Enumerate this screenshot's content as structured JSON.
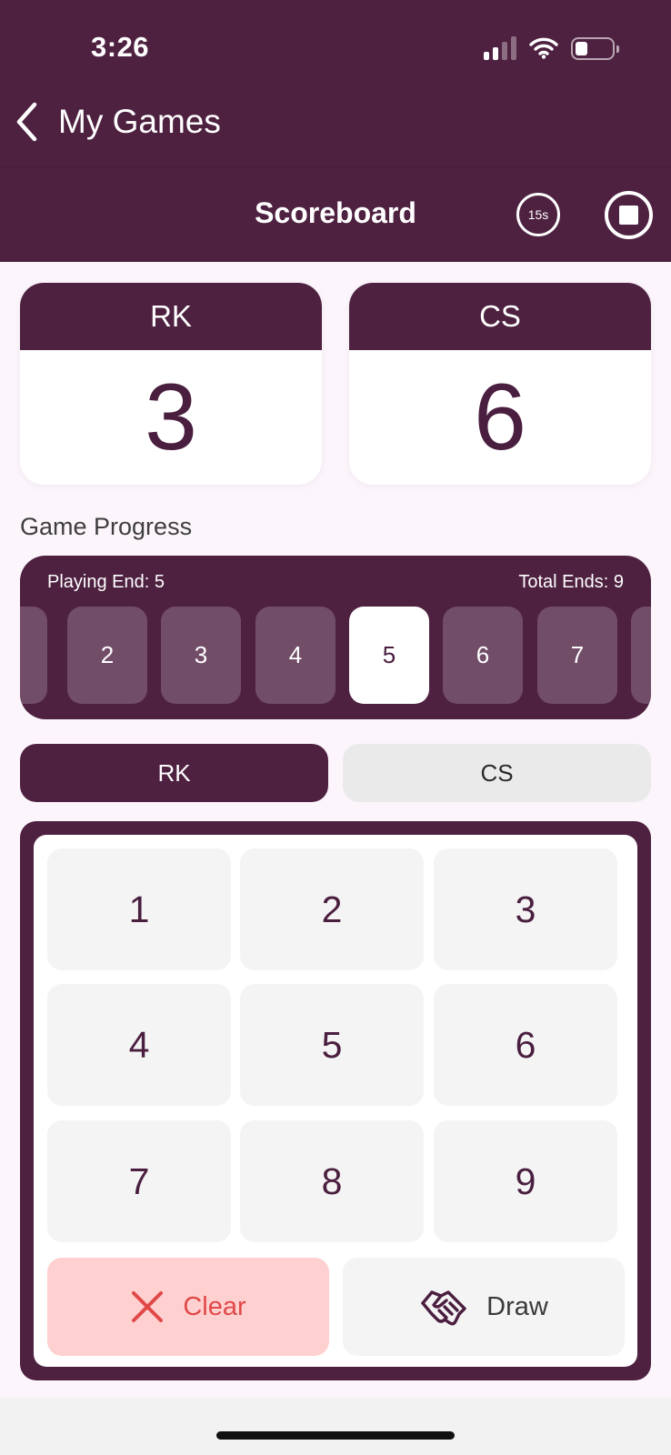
{
  "status_bar": {
    "time": "3:26"
  },
  "nav": {
    "back_label": "My Games"
  },
  "header": {
    "title": "Scoreboard",
    "timer_label": "15s"
  },
  "teams": [
    {
      "name": "RK",
      "score": "3"
    },
    {
      "name": "CS",
      "score": "6"
    }
  ],
  "progress": {
    "section_label": "Game Progress",
    "playing_end": "Playing End: 5",
    "total_ends": "Total Ends: 9",
    "ends": [
      "2",
      "3",
      "4",
      "5",
      "6",
      "7"
    ],
    "active_end": "5"
  },
  "team_toggle": {
    "selected": "RK",
    "other": "CS"
  },
  "keypad": {
    "keys": [
      "1",
      "2",
      "3",
      "4",
      "5",
      "6",
      "7",
      "8",
      "9"
    ],
    "clear_label": "Clear",
    "draw_label": "Draw"
  },
  "colors": {
    "primary": "#4E2140",
    "clear_bg": "#FFD0D0",
    "clear_text": "#E04848"
  }
}
